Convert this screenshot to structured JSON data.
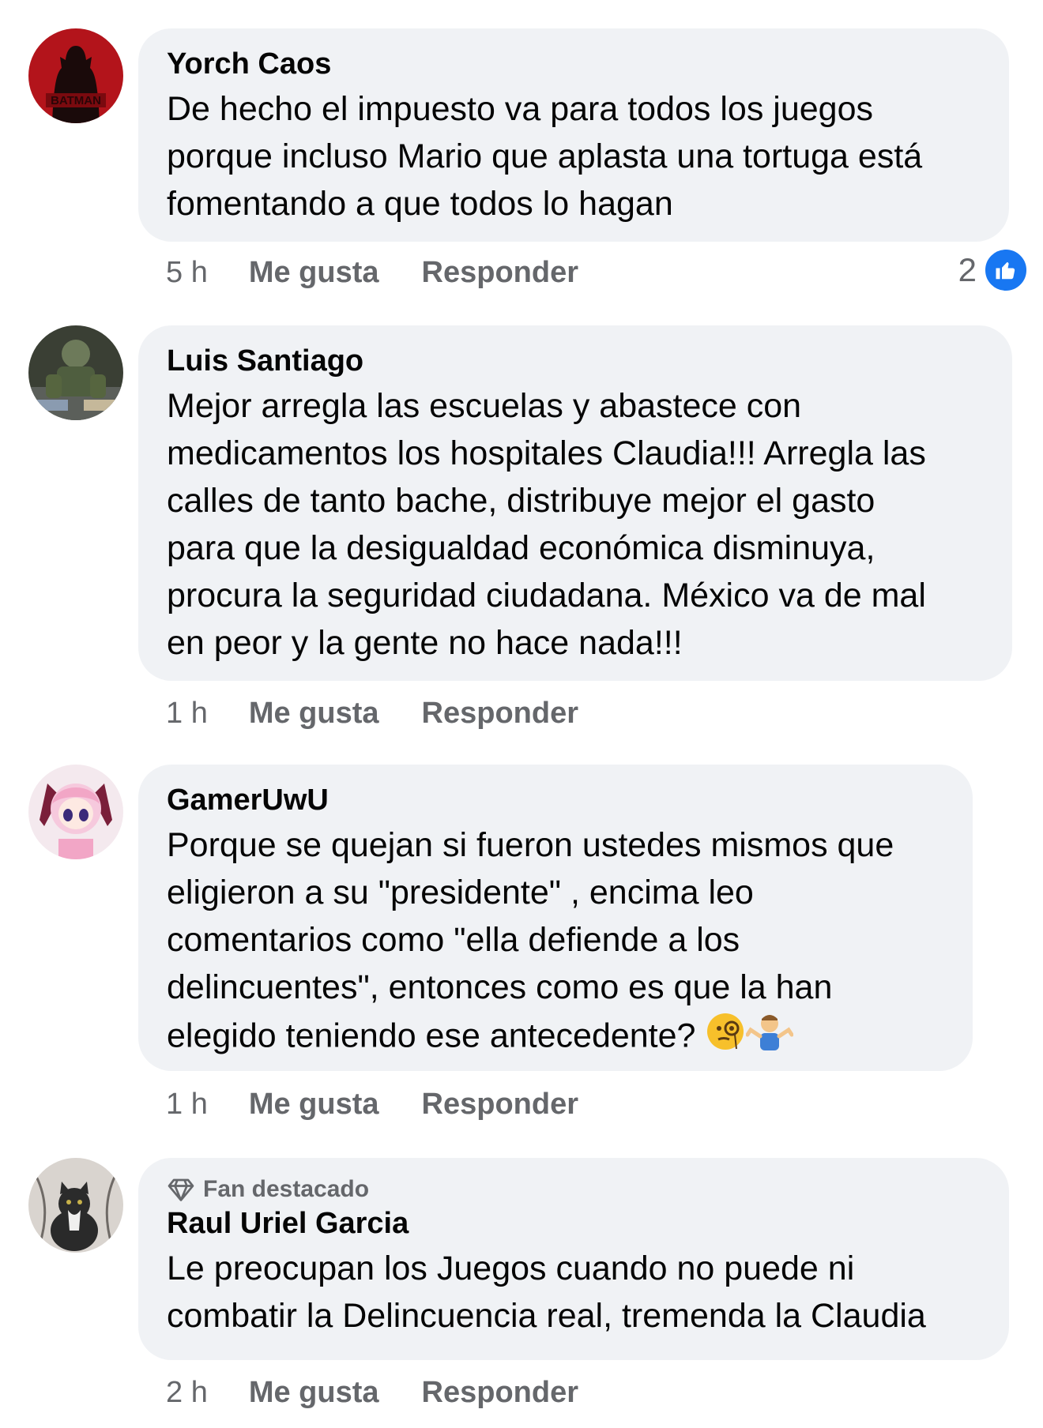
{
  "comments": [
    {
      "author": "Yorch Caos",
      "text": "De hecho el impuesto va para todos los juegos\nporque incluso Mario que aplasta una tortuga está\nfomentando a que todos lo hagan",
      "time": "5 h",
      "like_label": "Me gusta",
      "reply_label": "Responder",
      "reaction_count": "2",
      "avatar_text": "BATMAN"
    },
    {
      "author": "Luis Santiago",
      "text": "Mejor arregla las escuelas y abastece con\nmedicamentos los hospitales Claudia!!! Arregla las\ncalles de tanto bache, distribuye mejor el gasto\npara que la desigualdad económica disminuya,\nprocura la seguridad ciudadana. México va de mal\nen peor y la gente no hace nada!!!",
      "time": "1 h",
      "like_label": "Me gusta",
      "reply_label": "Responder"
    },
    {
      "author": "GamerUwU",
      "text": "Porque se quejan si fueron ustedes mismos que\neligieron a su \"presidente\" , encima leo\ncomentarios como \"ella defiende a los\ndelincuentes\", entonces como es que la han\nelegido teniendo ese antecedente?",
      "emojis": [
        "monocle-face-emoji",
        "person-shrugging-emoji"
      ],
      "time": "1 h",
      "like_label": "Me gusta",
      "reply_label": "Responder"
    },
    {
      "badge": "Fan destacado",
      "author": "Raul Uriel Garcia",
      "text": "Le preocupan los Juegos cuando no puede ni\ncombatir la Delincuencia real, tremenda la Claudia",
      "time": "2 h",
      "like_label": "Me gusta",
      "reply_label": "Responder"
    }
  ],
  "colors": {
    "bubble": "#f0f2f5",
    "secondary_text": "#65676b",
    "like_blue": "#1877f2"
  }
}
